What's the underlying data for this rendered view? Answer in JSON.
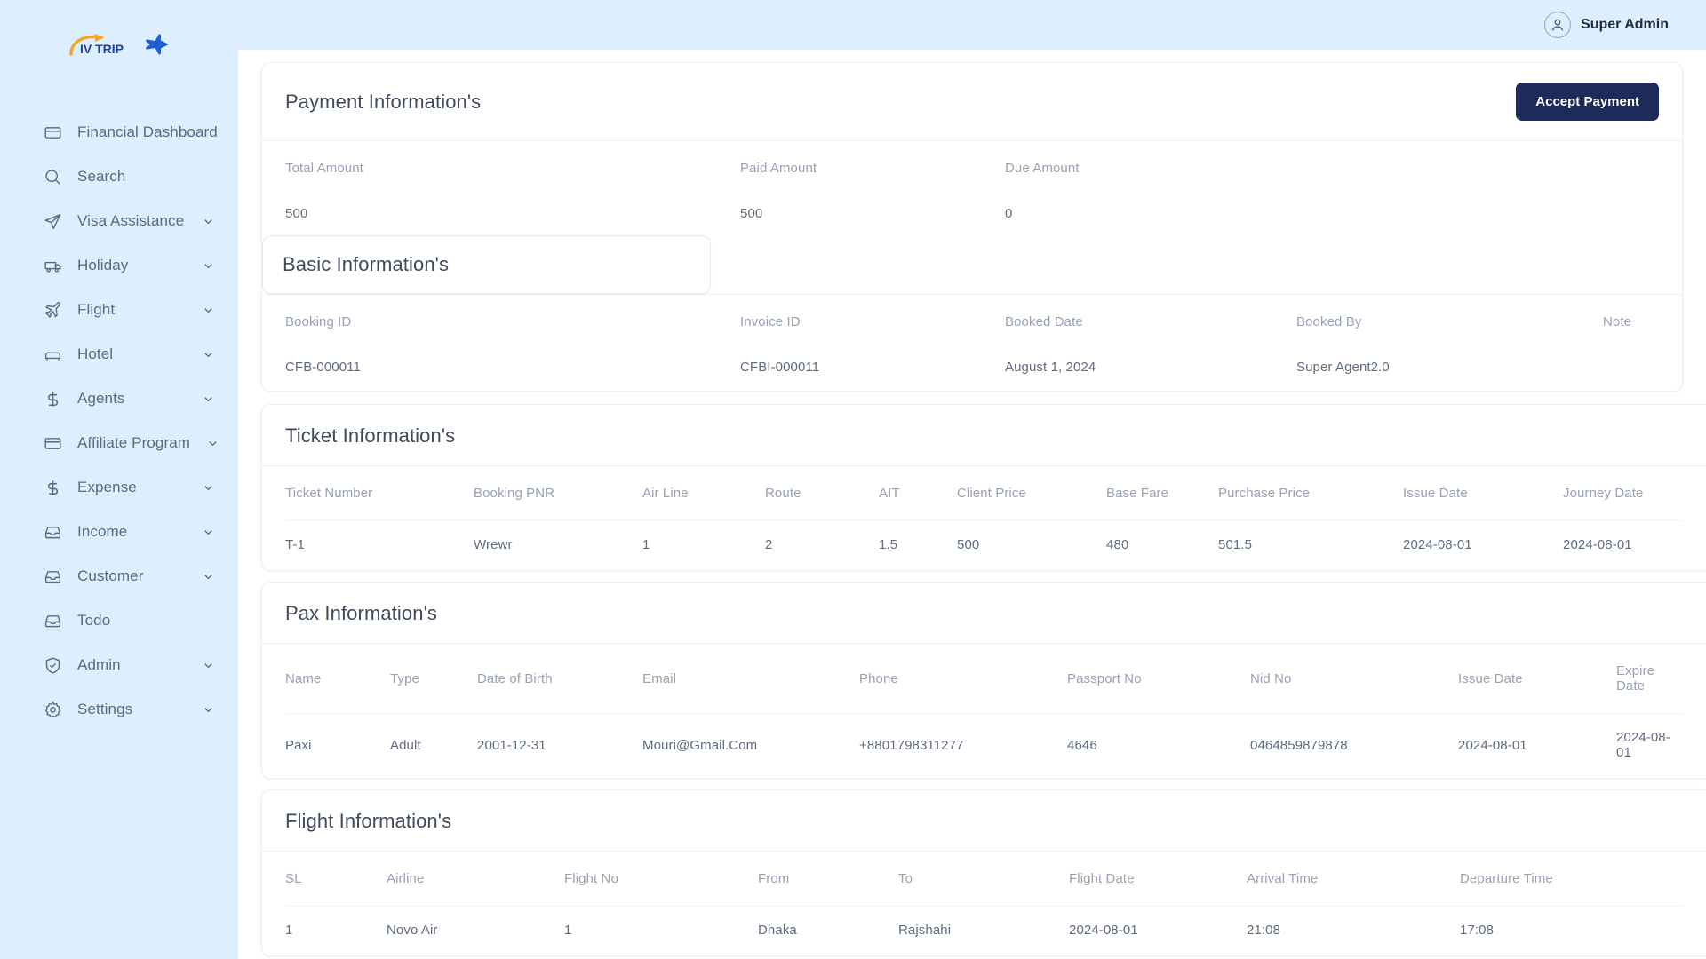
{
  "brand": {
    "name": "IV TRIP",
    "plane_icon": "plane-icon"
  },
  "topbar": {
    "user_name": "Super Admin",
    "avatar_icon": "user-avatar-icon"
  },
  "sidebar": {
    "items": [
      {
        "label": "Financial Dashboard",
        "icon": "credit-card-icon",
        "chevron": false
      },
      {
        "label": "Search",
        "icon": "search-icon",
        "chevron": false
      },
      {
        "label": "Visa Assistance",
        "icon": "paper-plane-icon",
        "chevron": true
      },
      {
        "label": "Holiday",
        "icon": "bus-icon",
        "chevron": true
      },
      {
        "label": "Flight",
        "icon": "airplane-icon",
        "chevron": true
      },
      {
        "label": "Hotel",
        "icon": "bed-icon",
        "chevron": true
      },
      {
        "label": "Agents",
        "icon": "dollar-icon",
        "chevron": true
      },
      {
        "label": "Affiliate Program",
        "icon": "credit-card-icon",
        "chevron": true
      },
      {
        "label": "Expense",
        "icon": "dollar-icon",
        "chevron": true
      },
      {
        "label": "Income",
        "icon": "inbox-icon",
        "chevron": true
      },
      {
        "label": "Customer",
        "icon": "inbox-icon",
        "chevron": true
      },
      {
        "label": "Todo",
        "icon": "inbox-icon",
        "chevron": false
      },
      {
        "label": "Admin",
        "icon": "shield-check-icon",
        "chevron": true
      },
      {
        "label": "Settings",
        "icon": "gear-icon",
        "chevron": true
      }
    ]
  },
  "payment": {
    "title": "Payment Information's",
    "accept_button": "Accept Payment",
    "fields": [
      {
        "label": "Total Amount",
        "value": "500"
      },
      {
        "label": "Paid Amount",
        "value": "500"
      },
      {
        "label": "Due Amount",
        "value": "0"
      }
    ]
  },
  "basic": {
    "title": "Basic Information's",
    "fields": [
      {
        "label": "Booking ID",
        "value": "CFB-000011"
      },
      {
        "label": "Invoice ID",
        "value": "CFBI-000011"
      },
      {
        "label": "Booked Date",
        "value": "August 1, 2024"
      },
      {
        "label": "Booked By",
        "value": "Super Agent2.0"
      },
      {
        "label": "Note",
        "value": ""
      }
    ]
  },
  "ticket": {
    "title": "Ticket Information's",
    "columns": [
      "Ticket Number",
      "Booking PNR",
      "Air Line",
      "Route",
      "AIT",
      "Client Price",
      "Base Fare",
      "Purchase Price",
      "Issue Date",
      "Journey Date"
    ],
    "rows": [
      [
        "T-1",
        "Wrewr",
        "1",
        "2",
        "1.5",
        "500",
        "480",
        "501.5",
        "2024-08-01",
        "2024-08-01"
      ]
    ]
  },
  "pax": {
    "title": "Pax Information's",
    "columns": [
      "Name",
      "Type",
      "Date of Birth",
      "Email",
      "Phone",
      "Passport No",
      "Nid No",
      "Issue Date",
      "Expire Date"
    ],
    "rows": [
      [
        "Paxi",
        "Adult",
        "2001-12-31",
        "Mouri@Gmail.Com",
        "+8801798311277",
        "4646",
        "0464859879878",
        "2024-08-01",
        "2024-08-01"
      ]
    ]
  },
  "flight": {
    "title": "Flight Information's",
    "columns": [
      "SL",
      "Airline",
      "Flight No",
      "From",
      "To",
      "Flight Date",
      "Arrival Time",
      "Departure Time"
    ],
    "rows": [
      [
        "1",
        "Novo Air",
        "1",
        "Dhaka",
        "Rajshahi",
        "2024-08-01",
        "21:08",
        "17:08"
      ]
    ]
  },
  "colors": {
    "sidebar_bg": "#ddeeff",
    "primary_button": "#1e2a5a",
    "brand_orange": "#f5a623",
    "brand_blue": "#1f3f9e",
    "text_muted": "#98a2b3"
  }
}
